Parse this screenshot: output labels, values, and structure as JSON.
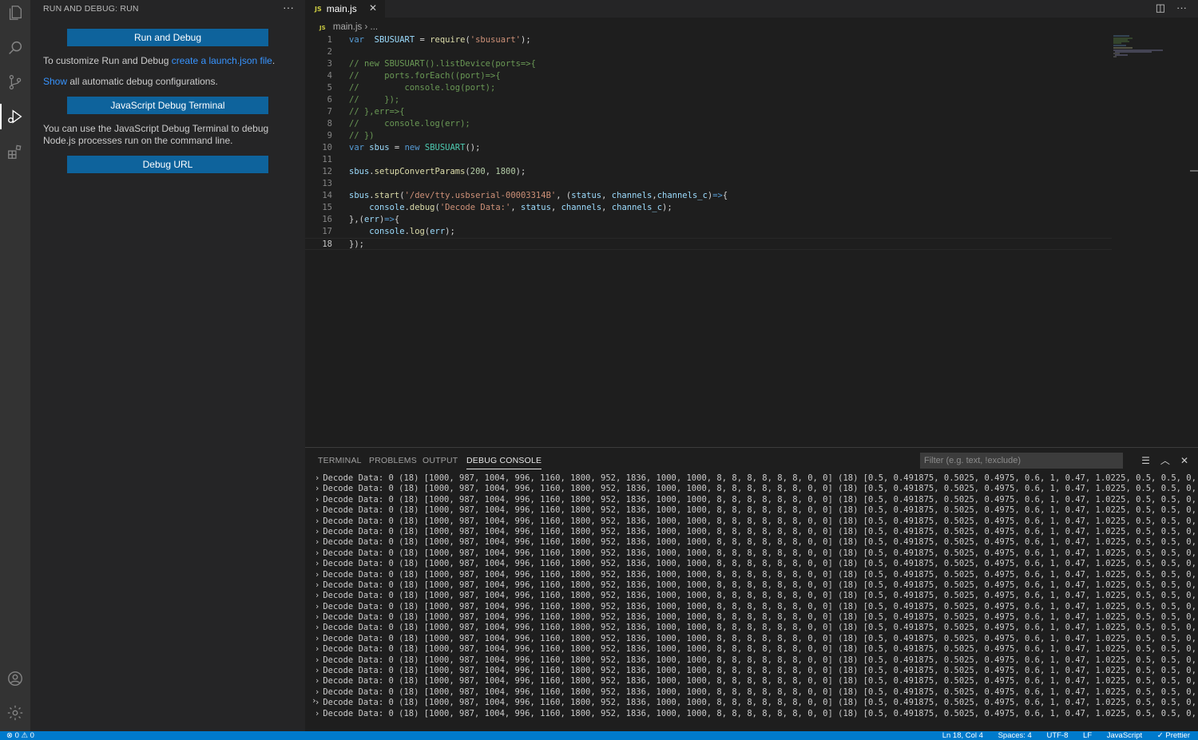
{
  "sidebar": {
    "title": "RUN AND DEBUG: RUN",
    "more": "···",
    "run_button": "Run and Debug",
    "customize_prefix": "To customize Run and Debug ",
    "customize_link": "create a launch.json file",
    "customize_suffix": ".",
    "show_link": "Show",
    "show_suffix": " all automatic debug configurations.",
    "terminal_button": "JavaScript Debug Terminal",
    "terminal_desc": "You can use the JavaScript Debug Terminal to debug Node.js processes run on the command line.",
    "url_button": "Debug URL"
  },
  "tabs": [
    {
      "label": "main.js",
      "badge": "JS",
      "close": "✕"
    }
  ],
  "breadcrumb": {
    "badge": "JS",
    "file": "main.js",
    "sep": "›",
    "rest": "..."
  },
  "editor": {
    "line_numbers": [
      "1",
      "2",
      "3",
      "4",
      "5",
      "6",
      "7",
      "8",
      "9",
      "10",
      "11",
      "12",
      "13",
      "14",
      "15",
      "16",
      "17",
      "18"
    ],
    "current_line": 18,
    "lines": [
      "var  SBUSUART = require('sbusuart');",
      "",
      "// new SBUSUART().listDevice(ports=>{",
      "//     ports.forEach((port)=>{",
      "//         console.log(port);",
      "//     });",
      "// },err=>{",
      "//     console.log(err);",
      "// })",
      "var sbus = new SBUSUART();",
      "",
      "sbus.setupConvertParams(200, 1800);",
      "",
      "sbus.start('/dev/tty.usbserial-00003314B', (status, channels,channels_c)=>{",
      "    console.debug('Decode Data:', status, channels, channels_c);",
      "},(err)=>{",
      "    console.log(err);",
      "});"
    ]
  },
  "panel": {
    "tabs": [
      "TERMINAL",
      "PROBLEMS",
      "OUTPUT",
      "DEBUG CONSOLE"
    ],
    "active_tab": "DEBUG CONSOLE",
    "filter_placeholder": "Filter (e.g. text, !exclude)",
    "console_line": "Decode Data: 0 (18) [1000, 987, 1004, 996, 1160, 1800, 952, 1836, 1000, 1000, 8, 8, 8, 8, 8, 8, 0, 0] (18) [0.5, 0.491875, 0.5025, 0.4975, 0.6, 1, 0.47, 1.0225, 0.5, 0.5, 0, 0, 0,",
    "console_line_count": 23,
    "prompt": "›"
  },
  "statusbar": {
    "errors": "⊗ 0 ⚠ 0",
    "right": [
      "Ln 18, Col 4",
      "Spaces: 4",
      "UTF-8",
      "LF",
      "JavaScript",
      "✓ Prettier"
    ]
  },
  "colors": {
    "accent": "#007acc",
    "button": "#0e639c",
    "link": "#3794ff"
  }
}
